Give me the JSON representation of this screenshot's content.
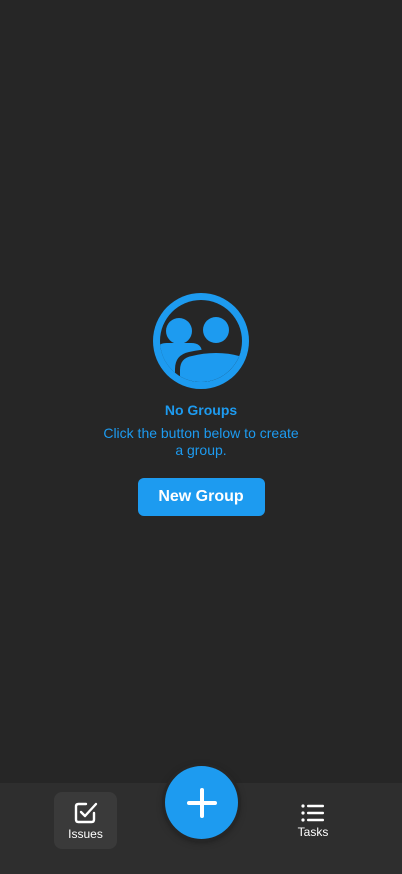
{
  "empty_state": {
    "icon": "group-icon",
    "title": "No Groups",
    "message": "Click the button below to create a group.",
    "button_label": "New Group"
  },
  "bottom_nav": {
    "items": [
      {
        "label": "Issues",
        "icon": "checkbox-icon",
        "active": true
      },
      {
        "label": "Tasks",
        "icon": "list-icon",
        "active": false
      }
    ],
    "fab_icon": "plus-icon"
  },
  "colors": {
    "background": "#262626",
    "nav_background": "#2e2e2e",
    "accent": "#1d9bf0",
    "text": "#ffffff"
  }
}
